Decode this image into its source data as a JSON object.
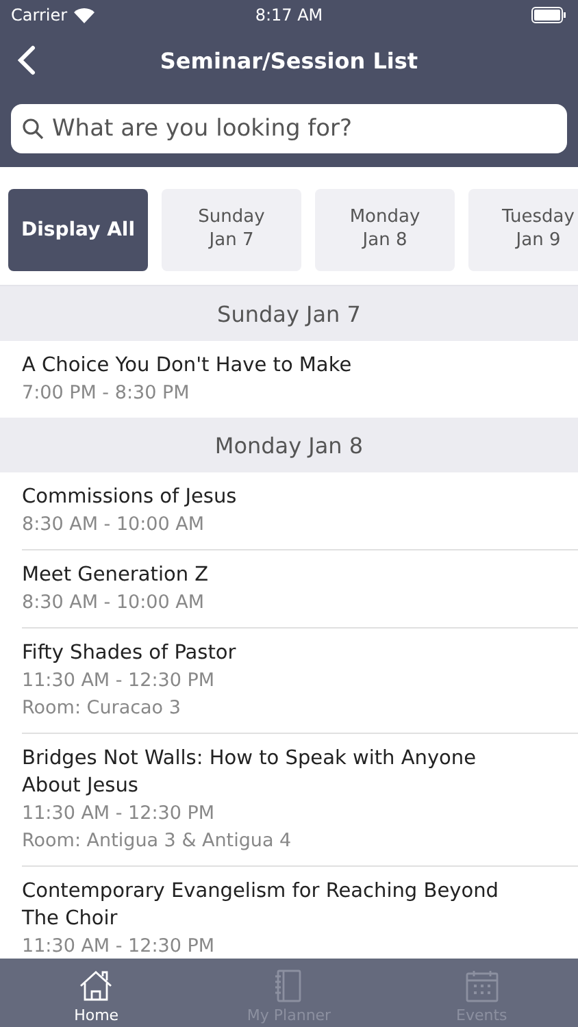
{
  "status_bar": {
    "carrier": "Carrier",
    "time": "8:17 AM"
  },
  "nav": {
    "title": "Seminar/Session List"
  },
  "search": {
    "placeholder": "What are you looking for?"
  },
  "filters": [
    {
      "line1": "Display All",
      "selected": true
    },
    {
      "line1": "Sunday",
      "line2": "Jan 7",
      "selected": false
    },
    {
      "line1": "Monday",
      "line2": "Jan 8",
      "selected": false
    },
    {
      "line1": "Tuesday",
      "line2": "Jan 9",
      "selected": false
    }
  ],
  "sections": [
    {
      "title": "Sunday Jan 7",
      "sessions": [
        {
          "title": "A Choice You Don't Have to Make",
          "time": "7:00 PM - 8:30 PM"
        }
      ]
    },
    {
      "title": "Monday Jan 8",
      "sessions": [
        {
          "title": "Commissions of Jesus",
          "time": "8:30 AM - 10:00 AM"
        },
        {
          "title": "Meet Generation Z",
          "time": "8:30 AM - 10:00 AM"
        },
        {
          "title": "Fifty Shades of Pastor",
          "time": "11:30 AM - 12:30 PM",
          "room": "Room: Curacao 3"
        },
        {
          "title": "Bridges Not Walls: How to Speak with Anyone About Jesus",
          "time": "11:30 AM - 12:30 PM",
          "room": "Room: Antigua 3 & Antigua 4"
        },
        {
          "title": "Contemporary Evangelism for Reaching Beyond The Choir",
          "time": "11:30 AM - 12:30 PM"
        }
      ]
    }
  ],
  "tab_bar": [
    {
      "label": "Home",
      "kind": "home",
      "selected": true
    },
    {
      "label": "My Planner",
      "kind": "planner",
      "selected": false
    },
    {
      "label": "Events",
      "kind": "events",
      "selected": false
    }
  ]
}
